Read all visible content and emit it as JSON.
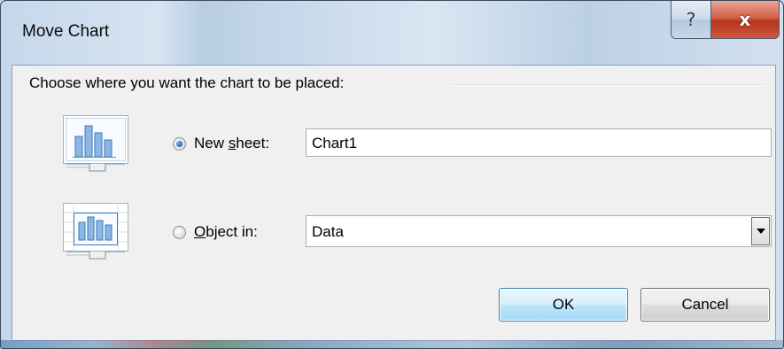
{
  "window": {
    "title": "Move Chart"
  },
  "controls": {
    "help_glyph": "?",
    "close_glyph": "x"
  },
  "prompt": "Choose where you want the chart to be placed:",
  "options": {
    "new_sheet": {
      "label_pre": "New ",
      "label_mnemonic": "s",
      "label_post": "heet:",
      "selected": true,
      "value": "Chart1"
    },
    "object_in": {
      "label_pre": "",
      "label_mnemonic": "O",
      "label_post": "bject in:",
      "selected": false,
      "value": "Data"
    }
  },
  "buttons": {
    "ok": "OK",
    "cancel": "Cancel"
  },
  "icons": {
    "new_sheet": "chart-new-sheet-icon",
    "object_in": "chart-object-in-icon",
    "combo_arrow": "chevron-down-icon"
  },
  "colors": {
    "accent": "#3c7fb1",
    "close": "#c13b1f",
    "radio_fill": "#1e5fb1"
  }
}
